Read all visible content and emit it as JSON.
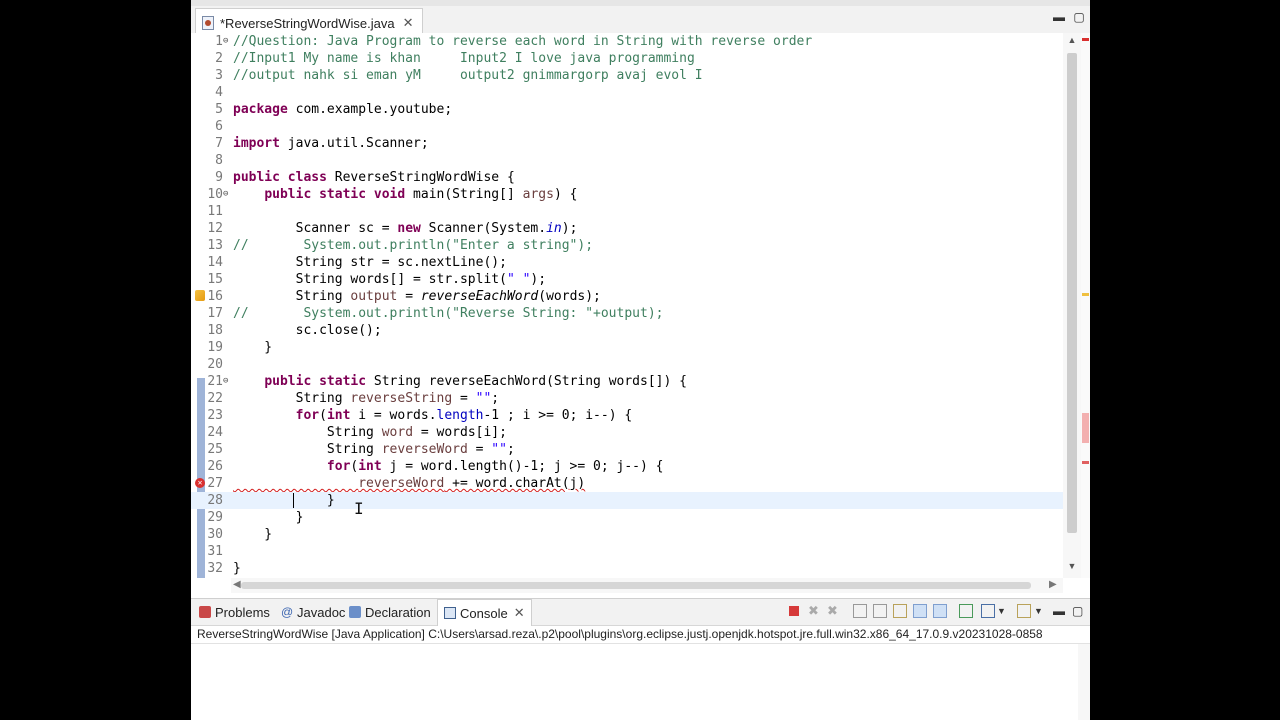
{
  "editor_tab": {
    "label": "*ReverseStringWordWise.java",
    "close": "✕"
  },
  "window_controls": {
    "minimize": "▬",
    "maximize": "▢"
  },
  "code": {
    "lines": [
      "//Question: Java Program to reverse each word in String with reverse order",
      "//Input1 My name is khan     Input2 I love java programming",
      "//output nahk si eman yM     output2 gnimmargorp avaj evol I",
      "",
      "package com.example.youtube;",
      "",
      "import java.util.Scanner;",
      "",
      "public class ReverseStringWordWise {",
      "    public static void main(String[] args) {",
      "",
      "        Scanner sc = new Scanner(System.in);",
      "//       System.out.println(\"Enter a string\");",
      "        String str = sc.nextLine();",
      "        String words[] = str.split(\" \");",
      "        String output = reverseEachWord(words);",
      "//       System.out.println(\"Reverse String: \"+output);",
      "        sc.close();",
      "    }",
      "",
      "    public static String reverseEachWord(String words[]) {",
      "        String reverseString = \"\";",
      "        for(int i = words.length-1 ; i >= 0; i--) {",
      "            String word = words[i];",
      "            String reverseWord = \"\";",
      "            for(int j = word.length()-1; j >= 0; j--) {",
      "                reverseWord += word.charAt(j)",
      "            }",
      "        }",
      "    }",
      "",
      "}"
    ]
  },
  "views": {
    "tabs": [
      "Problems",
      "Javadoc",
      "Declaration",
      "Console"
    ],
    "console_close": "✕",
    "console_path": "ReverseStringWordWise [Java Application] C:\\Users\\arsad.reza\\.p2\\pool\\plugins\\org.eclipse.justj.openjdk.hotspot.jre.full.win32.x86_64_17.0.9.v20231028-0858"
  },
  "colors": {
    "keyword": "#7f0055",
    "comment": "#3f7f5f",
    "string": "#2a00ff",
    "field": "#0000c0",
    "current_line": "#e8f2fe",
    "error": "#d9302f"
  }
}
